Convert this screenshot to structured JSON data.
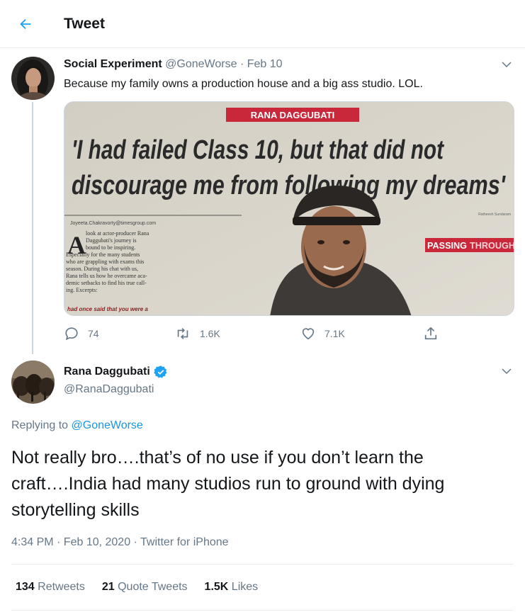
{
  "header": {
    "title": "Tweet",
    "back_icon": "arrow-left-icon",
    "accent": "#1da1f2"
  },
  "tweet1": {
    "name": "Social Experiment",
    "handle": "@GoneWorse",
    "sep": "·",
    "date": "Feb 10",
    "text": "Because my family owns a production house and a big ass studio. LOL.",
    "media": {
      "banner": "RANA DAGGUBATI",
      "headline_line1": "'I had failed Class 10, but that did not",
      "headline_line2": "discourage me from following my dreams'",
      "byline": "Joyeeta.Chakravorty@timesgroup.com",
      "photo_credit": "Ratheesh Sundaram",
      "passing_label": "PASSING",
      "through_label": "THROUGH",
      "body_lines": [
        "look at actor-producer Rana",
        "Daggubati's journey is",
        "bound to be inspiring.",
        "Especially for the many students",
        "who are grappling with exams this",
        "season. During his chat with us,",
        "Rana tells us how he overcame aca-",
        "demic setbacks to find his true call-",
        "ing. Excerpts:"
      ],
      "drop_cap": "A",
      "question": "had once said that you were a"
    },
    "actions": {
      "replies": "74",
      "retweets": "1.6K",
      "likes": "7.1K"
    }
  },
  "tweet2": {
    "name": "Rana Daggubati",
    "handle": "@RanaDaggubati",
    "verified_color": "#1da1f2",
    "replying_prefix": "Replying to",
    "replying_to": "@GoneWorse",
    "text": "Not really bro….that’s of no use if you don’t learn the craft….India had many studios run to ground with dying storytelling skills",
    "timestamp": "4:34 PM · Feb 10, 2020 · Twitter for iPhone",
    "stats": {
      "retweets_count": "134",
      "retweets_label": "Retweets",
      "quotes_count": "21",
      "quotes_label": "Quote Tweets",
      "likes_count": "1.5K",
      "likes_label": "Likes"
    }
  }
}
